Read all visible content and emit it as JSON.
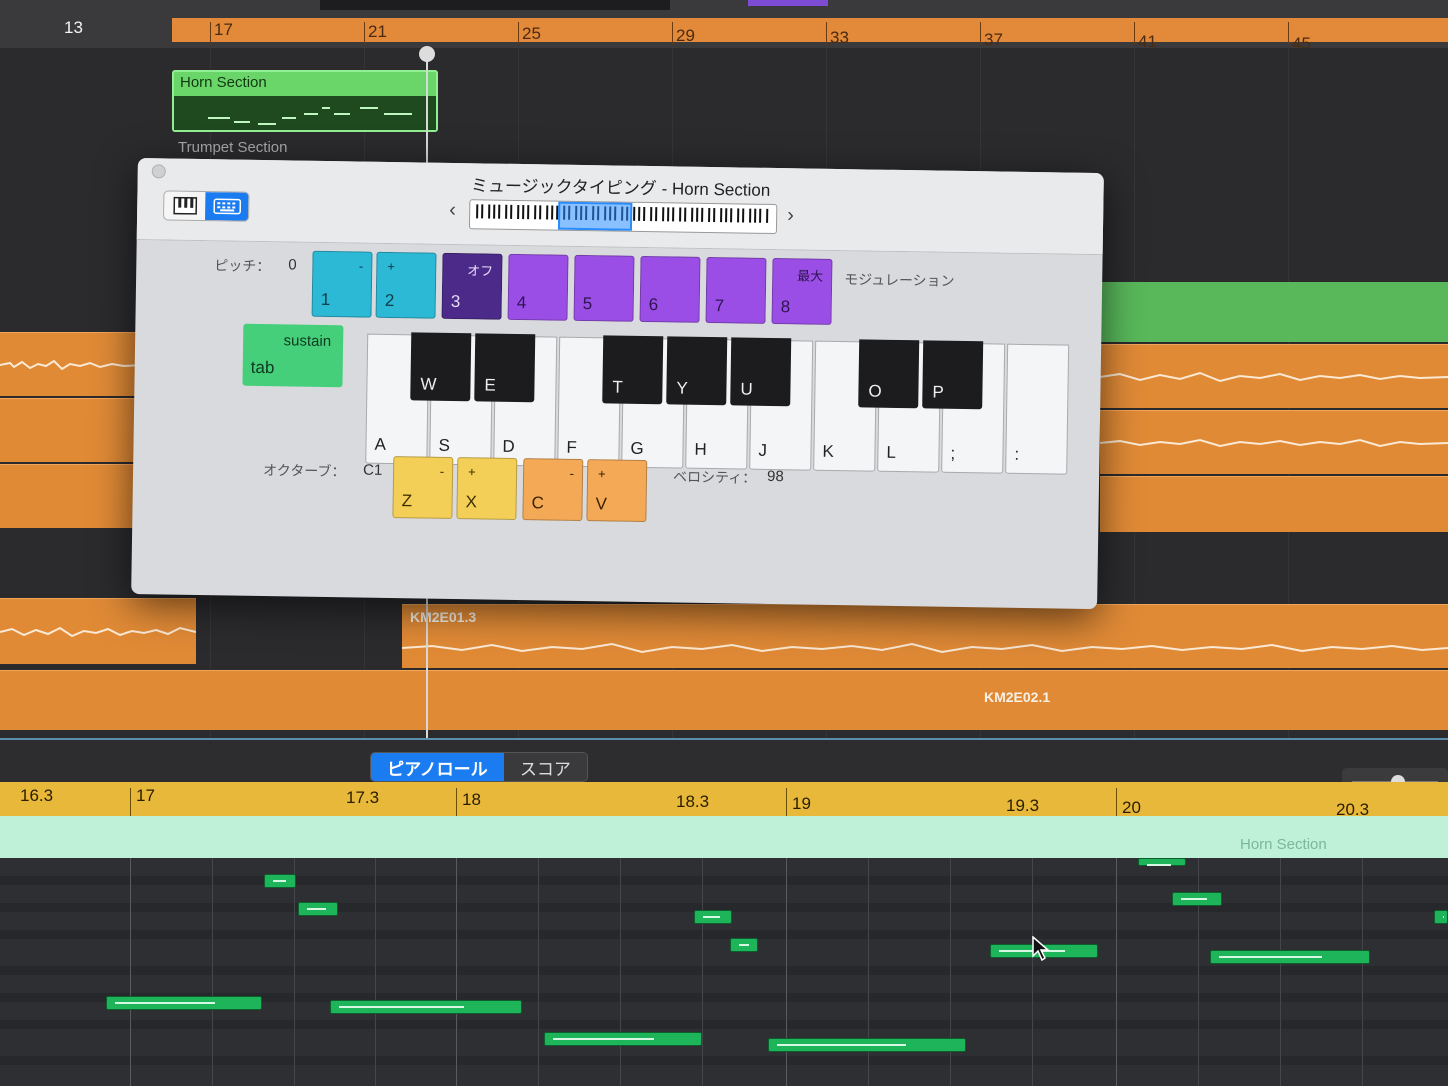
{
  "top_ruler": {
    "bars": [
      "13",
      "17",
      "21",
      "25",
      "29",
      "33",
      "37",
      "41",
      "45"
    ]
  },
  "tracks": {
    "horn_region": {
      "label": "Horn Section"
    },
    "trumpet_label": "Trumpet Section",
    "audio_regions": [
      {
        "label": "KM2E01.3"
      },
      {
        "label": "KM2E02.1"
      }
    ]
  },
  "dialog": {
    "title": "ミュージックタイピング - Horn Section",
    "mode_toggle": {
      "piano_icon": "piano-icon",
      "keyboard_icon": "keyboard-icon"
    },
    "pitch": {
      "label": "ピッチ：",
      "value": "0"
    },
    "pitch_pads": [
      {
        "top": "-",
        "key": "1"
      },
      {
        "top": "+",
        "key": "2"
      }
    ],
    "modulation_pads": [
      {
        "top": "オフ",
        "key": "3"
      },
      {
        "top": "",
        "key": "4"
      },
      {
        "top": "",
        "key": "5"
      },
      {
        "top": "",
        "key": "6"
      },
      {
        "top": "",
        "key": "7"
      },
      {
        "top": "最大",
        "key": "8"
      }
    ],
    "modulation_label": "モジュレーション",
    "sustain": {
      "label": "sustain",
      "key": "tab"
    },
    "white_keys": [
      "A",
      "S",
      "D",
      "F",
      "G",
      "H",
      "J",
      "K",
      "L",
      ";",
      ":"
    ],
    "black_keys": [
      "W",
      "E",
      "T",
      "Y",
      "U",
      "O",
      "P"
    ],
    "octave": {
      "label": "オクターブ：",
      "value": "C1"
    },
    "octave_pads": [
      {
        "top": "-",
        "key": "Z"
      },
      {
        "top": "+",
        "key": "X"
      }
    ],
    "velocity_pads": [
      {
        "top": "-",
        "key": "C"
      },
      {
        "top": "+",
        "key": "V"
      }
    ],
    "velocity": {
      "label": "ベロシティ：",
      "value": "98"
    }
  },
  "editor": {
    "tabs": [
      {
        "label": "ピアノロール",
        "selected": true
      },
      {
        "label": "スコア",
        "selected": false
      }
    ],
    "ruler": [
      "16.3",
      "17",
      "17.3",
      "18",
      "18.3",
      "19",
      "19.3",
      "20",
      "20.3"
    ],
    "region_label": "Horn Section"
  },
  "colors": {
    "cycle": "#e28a3a",
    "region_green": "#6ad66a",
    "audio_orange": "#e08a36",
    "accent_blue": "#1b7cf2",
    "note_green": "#1db45a",
    "pad_teal": "#2bb9d6",
    "pad_purple": "#9b4ee6",
    "pad_yellow": "#f4cf57",
    "pad_orange": "#f3a956"
  }
}
